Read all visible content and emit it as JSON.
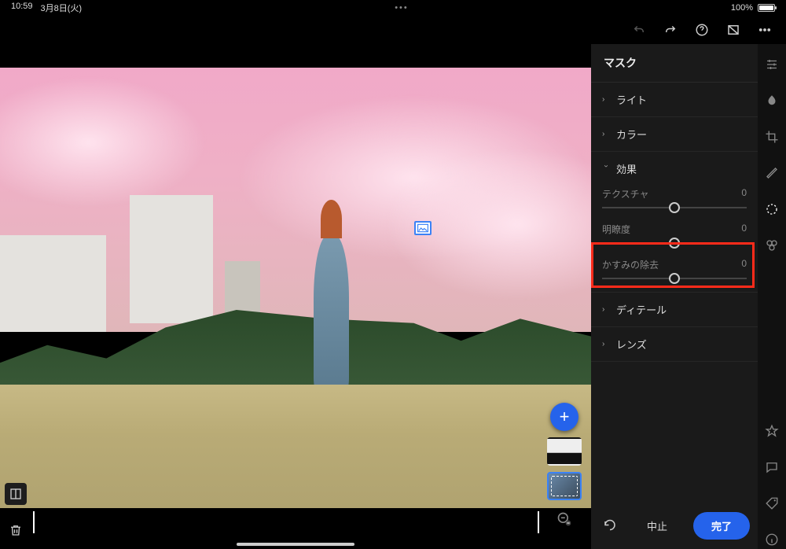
{
  "status": {
    "time": "10:59",
    "date": "3月8日(火)",
    "battery": "100%"
  },
  "panel": {
    "title": "マスク",
    "sections": {
      "light": "ライト",
      "color": "カラー",
      "effects": "効果",
      "detail": "ディテール",
      "lens": "レンズ"
    },
    "sliders": {
      "texture": {
        "label": "テクスチャ",
        "value": "0"
      },
      "clarity": {
        "label": "明瞭度",
        "value": "0"
      },
      "dehaze": {
        "label": "かすみの除去",
        "value": "0"
      }
    }
  },
  "footer": {
    "cancel": "中止",
    "done": "完了"
  },
  "add_label": "+"
}
